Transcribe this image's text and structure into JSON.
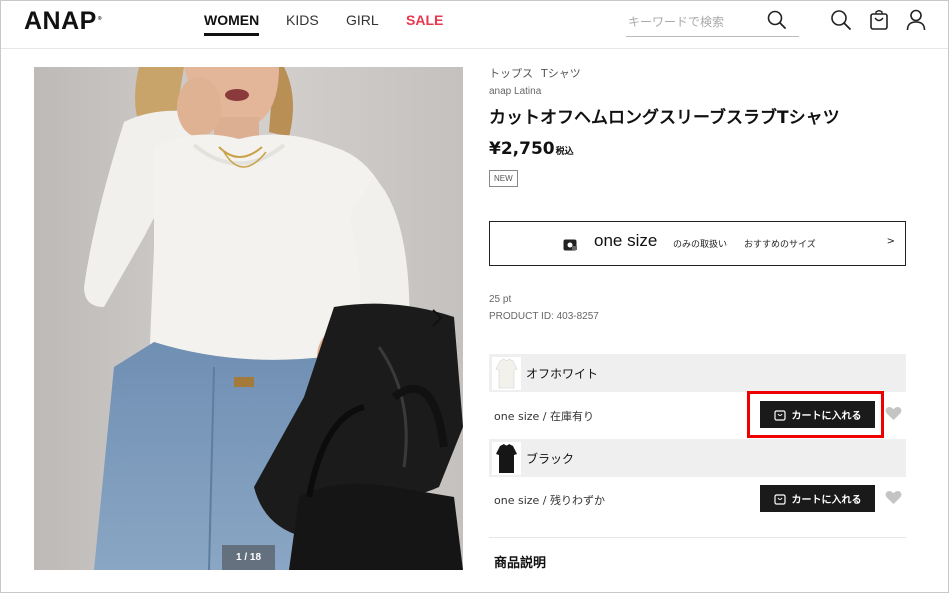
{
  "header": {
    "logo": "ANAP",
    "logo_mark": "®",
    "nav": [
      {
        "label": "WOMEN",
        "active": true
      },
      {
        "label": "KIDS",
        "active": false
      },
      {
        "label": "GIRL",
        "active": false
      },
      {
        "label": "SALE",
        "active": false,
        "color": "#e8384f"
      }
    ],
    "search_placeholder": "キーワードで検索",
    "icons": [
      "search-icon",
      "search-icon",
      "cart-icon",
      "user-icon"
    ]
  },
  "gallery": {
    "counter": "1 / 18",
    "next_icon": "chevron-right-icon"
  },
  "product": {
    "breadcrumbs": [
      "トップス",
      "Tシャツ"
    ],
    "brand": "anap Latina",
    "title": "カットオフヘムロングスリーブスラブTシャツ",
    "price": "¥2,750",
    "tax_label": "税込",
    "badge": "NEW",
    "size_box": {
      "size": "one size",
      "note": "のみの取扱い",
      "recommend": "おすすめのサイズ",
      "arrow": ">"
    },
    "points": "25 pt",
    "product_id": "PRODUCT ID: 403-8257"
  },
  "variants": [
    {
      "color_name": "オフホワイト",
      "stock": "one size / 在庫有り",
      "button": "カートに入れる"
    },
    {
      "color_name": "ブラック",
      "stock": "one size / 残りわずか",
      "button": "カートに入れる"
    }
  ],
  "description_heading": "商品説明",
  "colors": {
    "sale": "#e8384f",
    "button": "#1a1a1a",
    "highlight": "#e00000"
  }
}
